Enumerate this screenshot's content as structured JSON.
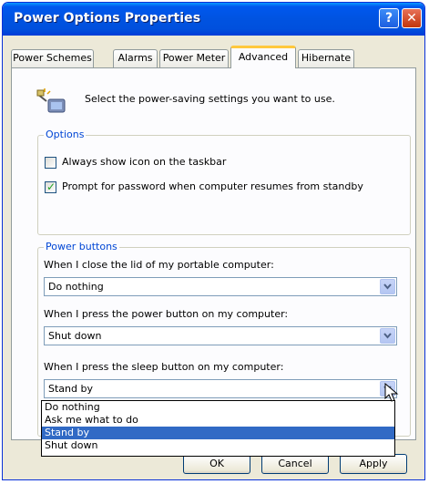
{
  "window": {
    "title": "Power Options Properties"
  },
  "tabs": [
    {
      "label": "Power Schemes"
    },
    {
      "label": "Alarms"
    },
    {
      "label": "Power Meter"
    },
    {
      "label": "Advanced"
    },
    {
      "label": "Hibernate"
    }
  ],
  "header": {
    "text": "Select the power-saving settings you want to use."
  },
  "options": {
    "label": "Options",
    "always_show_icon": {
      "label": "Always show icon on the taskbar",
      "checked": false
    },
    "prompt_password": {
      "label": "Prompt for password when computer resumes from standby",
      "checked": true
    }
  },
  "power_buttons": {
    "label": "Power buttons",
    "lid": {
      "label": "When I close the lid of my portable computer:",
      "value": "Do nothing"
    },
    "power": {
      "label": "When I press the power button on my computer:",
      "value": "Shut down"
    },
    "sleep": {
      "label": "When I press the sleep button on my computer:",
      "value": "Stand by"
    }
  },
  "dropdown": {
    "options": [
      "Do nothing",
      "Ask me what to do",
      "Stand by",
      "Shut down"
    ],
    "selected": "Stand by"
  },
  "buttons": {
    "ok": "OK",
    "cancel": "Cancel",
    "apply": "Apply"
  },
  "colors": {
    "titlebar": "#0058ee",
    "group_label": "#0046d5",
    "selection": "#316ac5"
  }
}
